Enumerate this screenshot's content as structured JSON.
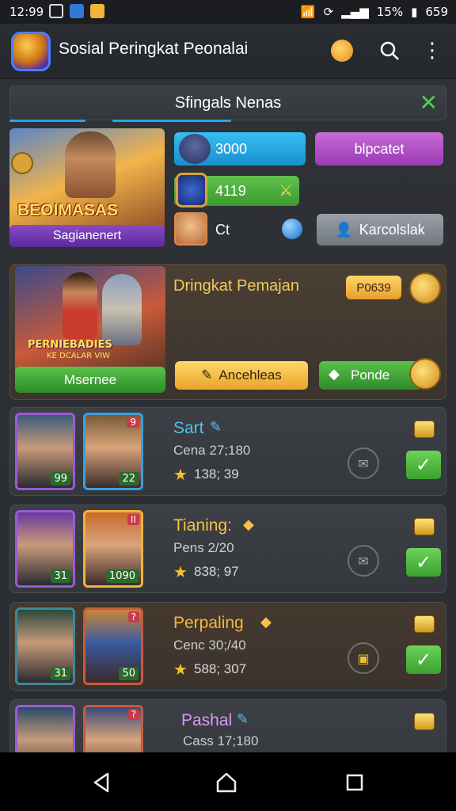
{
  "status": {
    "time": "12:99",
    "battery": "15%",
    "extra": "659"
  },
  "app": {
    "title": "Sosial Peringkat Peonalai"
  },
  "section": {
    "title": "Sfingals Nenas"
  },
  "profile": {
    "banner_text": "BEOIMASAS",
    "banner_label": "Sagianenert",
    "stat1": "3000",
    "stat1_action": "blpcatet",
    "stat2": "4119",
    "mini_label": "Ct",
    "mini_action": "Karcolslak"
  },
  "rank_panel": {
    "image_text": "PERNIEBADIES",
    "image_sub": "KE DCALAR VIW",
    "image_label": "Msernee",
    "title": "Dringkat Pemajan",
    "code": "P0639",
    "btn1": "Ancehleas",
    "btn2": "Ponde"
  },
  "cards": [
    {
      "name": "Sart",
      "name_color": "#4fc3f0",
      "sub": "Cena 27;180",
      "stars": "138; 39",
      "av1_lvl": "99",
      "av2_lvl": "22",
      "av2_badge": "9"
    },
    {
      "name": "Tianing:",
      "name_color": "#f5c244",
      "sub": "Pens 2/20",
      "stars": "838; 97",
      "av1_lvl": "31",
      "av2_lvl": "1090",
      "av2_badge": "II"
    },
    {
      "name": "Perpaling",
      "name_color": "#f5b63a",
      "sub": "Cenc 30;/40",
      "stars": "588; 307",
      "av1_lvl": "31",
      "av2_lvl": "50",
      "av2_badge": "?"
    },
    {
      "name": "Pashal",
      "name_color": "#d79af5",
      "sub": "Cass 17;180",
      "stars": "",
      "av1_lvl": "",
      "av2_lvl": "",
      "av2_badge": "?"
    }
  ],
  "icons": {
    "back": "back-icon",
    "home": "home-icon",
    "recents": "recents-icon",
    "menu": "more-vert-icon",
    "search": "search-icon",
    "map": "map-pin-icon"
  },
  "colors": {
    "accent_blue": "#1ea9e6",
    "accent_purple": "#b04fc9",
    "accent_green": "#4fb43f",
    "gold": "#f0b43a"
  }
}
